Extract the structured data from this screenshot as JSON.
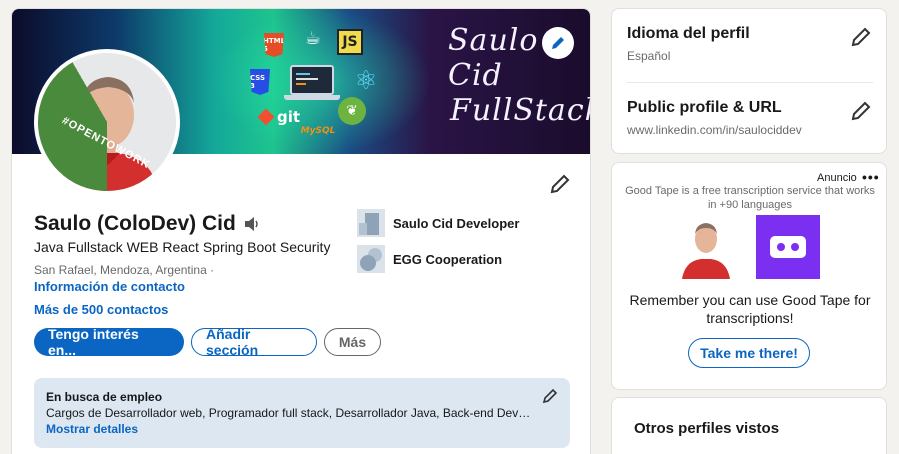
{
  "banner": {
    "script_line1": "Saulo Cid",
    "script_line2": "FullStack",
    "tech_labels": {
      "html": "HTML 5",
      "js": "JS",
      "css": "CSS 3",
      "git": "git",
      "mysql": "MySQL"
    },
    "badge": "#OPENTOWORK"
  },
  "profile": {
    "name": "Saulo (ColoDev) Cid",
    "headline": "Java Fullstack WEB React Spring Boot Security",
    "location": "San Rafael, Mendoza, Argentina ·",
    "contact_info": "Información de contacto",
    "connections": "Más de 500 contactos",
    "orgs": [
      {
        "name": "Saulo Cid Developer"
      },
      {
        "name": "EGG Cooperation"
      }
    ],
    "buttons": {
      "primary": "Tengo interés en...",
      "secondary": "Añadir sección",
      "tertiary": "Más"
    },
    "open_to_work": {
      "title": "En busca de empleo",
      "description": "Cargos de Desarrollador web, Programador full stack, Desarrollador Java, Back-end Developer, Front-end Developer",
      "link": "Mostrar detalles"
    }
  },
  "sidebar": {
    "language": {
      "title": "Idioma del perfil",
      "value": "Español"
    },
    "public_url": {
      "title": "Public profile & URL",
      "value": "www.linkedin.com/in/saulociddev"
    },
    "ad": {
      "label": "Anuncio",
      "more": "•••",
      "text": "Good Tape is a free transcription service that works in +90 languages",
      "body": "Remember you can use Good Tape for transcriptions!",
      "cta": "Take me there!"
    },
    "others": {
      "title": "Otros perfiles vistos"
    }
  },
  "colors": {
    "accent": "#0a66c2",
    "open_to_work_green": "#4a8a3c",
    "ad_brand": "#7b2ff0"
  }
}
